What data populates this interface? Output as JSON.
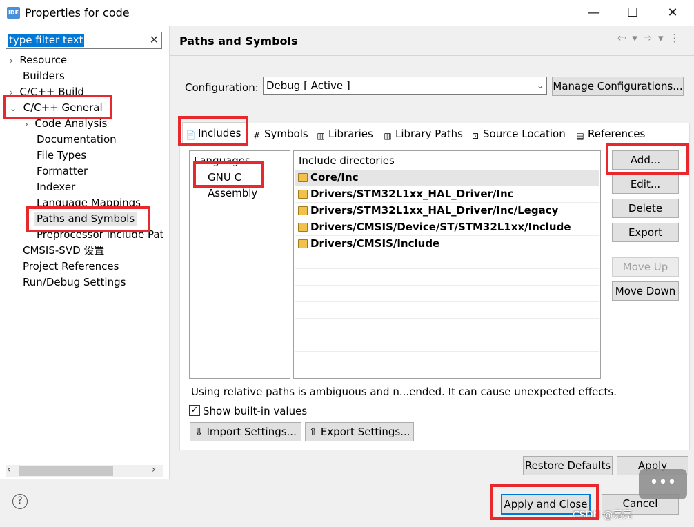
{
  "window": {
    "title": "Properties for code",
    "app_icon": "IDE",
    "minimize": "—",
    "maximize": "☐",
    "close": "✕"
  },
  "filter": {
    "value": "type filter text",
    "clear": "✕"
  },
  "tree": [
    {
      "label": "Resource",
      "chev": "›"
    },
    {
      "label": "Builders",
      "chev": ""
    },
    {
      "label": "C/C++ Build",
      "chev": "›"
    },
    {
      "label": "C/C++ General",
      "chev": "⌄"
    },
    {
      "label": "Code Analysis",
      "chev": "›"
    },
    {
      "label": "Documentation",
      "chev": ""
    },
    {
      "label": "File Types",
      "chev": ""
    },
    {
      "label": "Formatter",
      "chev": ""
    },
    {
      "label": "Indexer",
      "chev": ""
    },
    {
      "label": "Language Mappings",
      "chev": ""
    },
    {
      "label": "Paths and Symbols",
      "chev": ""
    },
    {
      "label": "Preprocessor Include Path",
      "chev": ""
    },
    {
      "label": "CMSIS-SVD 设置",
      "chev": ""
    },
    {
      "label": "Project References",
      "chev": ""
    },
    {
      "label": "Run/Debug Settings",
      "chev": ""
    }
  ],
  "scroll": {
    "left": "‹",
    "right": "›"
  },
  "page": {
    "heading": "Paths and Symbols",
    "nav": "⇦ ▾ ⇨ ▾ ⋮"
  },
  "config": {
    "label": "Configuration:",
    "value": "Debug  [ Active ]",
    "arrow": "⌄",
    "manage": "Manage Configurations..."
  },
  "tabs": [
    {
      "label": "Includes",
      "icon": "📄"
    },
    {
      "label": "Symbols",
      "icon": "#"
    },
    {
      "label": "Libraries",
      "icon": "▥"
    },
    {
      "label": "Library Paths",
      "icon": "▥"
    },
    {
      "label": "Source Location",
      "icon": "⊡"
    },
    {
      "label": "References",
      "icon": "▤"
    }
  ],
  "languages": {
    "header": "Languages",
    "items": [
      "GNU C",
      "Assembly"
    ]
  },
  "includes": {
    "header": "Include directories",
    "rows": [
      "Core/Inc",
      "Drivers/STM32L1xx_HAL_Driver/Inc",
      "Drivers/STM32L1xx_HAL_Driver/Inc/Legacy",
      "Drivers/CMSIS/Device/ST/STM32L1xx/Include",
      "Drivers/CMSIS/Include"
    ]
  },
  "side_buttons": {
    "add": "Add...",
    "edit": "Edit...",
    "delete": "Delete",
    "export": "Export",
    "move_up": "Move Up",
    "move_down": "Move Down"
  },
  "warning": "Using relative paths is ambiguous and n...ended. It can cause unexpected effects.",
  "show_builtin": {
    "label": "Show built-in values",
    "checked": true,
    "mark": "✓"
  },
  "import_settings": "Import Settings...",
  "export_settings": "Export Settings...",
  "restore_defaults": "Restore Defaults",
  "apply": "Apply",
  "apply_close": "Apply and Close",
  "cancel": "Cancel",
  "help": "?",
  "watermark": "CSDN @亮亮",
  "colors": {
    "highlight": "#e8282d",
    "selection": "#0078d7"
  }
}
